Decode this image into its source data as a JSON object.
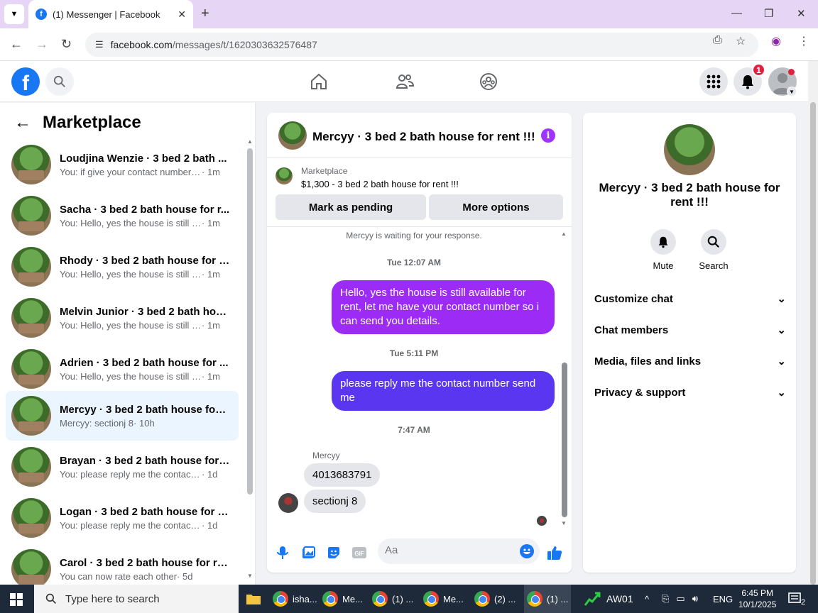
{
  "browser": {
    "tab_title": "(1) Messenger | Facebook",
    "url_domain": "facebook.com",
    "url_path": "/messages/t/1620303632576487"
  },
  "fb": {
    "notification_count": "1"
  },
  "sidebar": {
    "title": "Marketplace",
    "conversations": [
      {
        "name": "Loudjina Wenzie · 3 bed 2 bath ...",
        "msg": "You: if give your contact number s...",
        "time": "· 1m"
      },
      {
        "name": "Sacha · 3 bed 2 bath house for r...",
        "msg": "You: Hello, yes the house is still av...",
        "time": "· 1m"
      },
      {
        "name": "Rhody · 3 bed 2 bath house for r...",
        "msg": "You: Hello, yes the house is still av...",
        "time": "· 1m"
      },
      {
        "name": "Melvin Junior · 3 bed 2 bath hou...",
        "msg": "You: Hello, yes the house is still av...",
        "time": "· 1m"
      },
      {
        "name": "Adrien · 3 bed 2 bath house for ...",
        "msg": "You: Hello, yes the house is still av...",
        "time": "· 1m"
      },
      {
        "name": "Mercyy · 3 bed 2 bath house for ...",
        "msg": "Mercyy: sectionj 8",
        "time": "· 10h"
      },
      {
        "name": "Brayan · 3 bed 2 bath house for ...",
        "msg": "You: please reply me the contact n...",
        "time": "· 1d"
      },
      {
        "name": "Logan · 3 bed 2 bath house for r...",
        "msg": "You: please reply me the contact n...",
        "time": "· 1d"
      },
      {
        "name": "Carol · 3 bed 2 bath house for re...",
        "msg": "You can now rate each other",
        "time": "· 5d"
      }
    ]
  },
  "chat": {
    "title": "Mercyy · 3 bed 2 bath house for rent !!!",
    "marketplace_label": "Marketplace",
    "listing": "$1,300 - 3 bed 2 bath house for rent !!!",
    "btn_pending": "Mark as pending",
    "btn_more": "More options",
    "waiting": "Mercyy is waiting for your response.",
    "time1": "Tue 12:07 AM",
    "msg1": "Hello, yes the house is still available for rent, let me have your contact number so i can send you details.",
    "time2": "Tue 5:11 PM",
    "msg2": "please reply me the contact number send me",
    "time3": "7:47 AM",
    "sender": "Mercyy",
    "in1": "4013683791",
    "in2": "sectionj 8",
    "input_placeholder": "Aa"
  },
  "details": {
    "name": "Mercyy · 3 bed 2 bath house for rent !!!",
    "mute": "Mute",
    "search": "Search",
    "rows": [
      "Customize chat",
      "Chat members",
      "Media, files and links",
      "Privacy & support"
    ]
  },
  "taskbar": {
    "search_placeholder": "Type here to search",
    "items": [
      "isha...",
      "Me...",
      "(1) ...",
      "Me...",
      "(2) ...",
      "(1) ..."
    ],
    "weather": "AW01",
    "lang": "ENG",
    "time": "6:45 PM",
    "date": "10/1/2025",
    "notif": "2"
  }
}
